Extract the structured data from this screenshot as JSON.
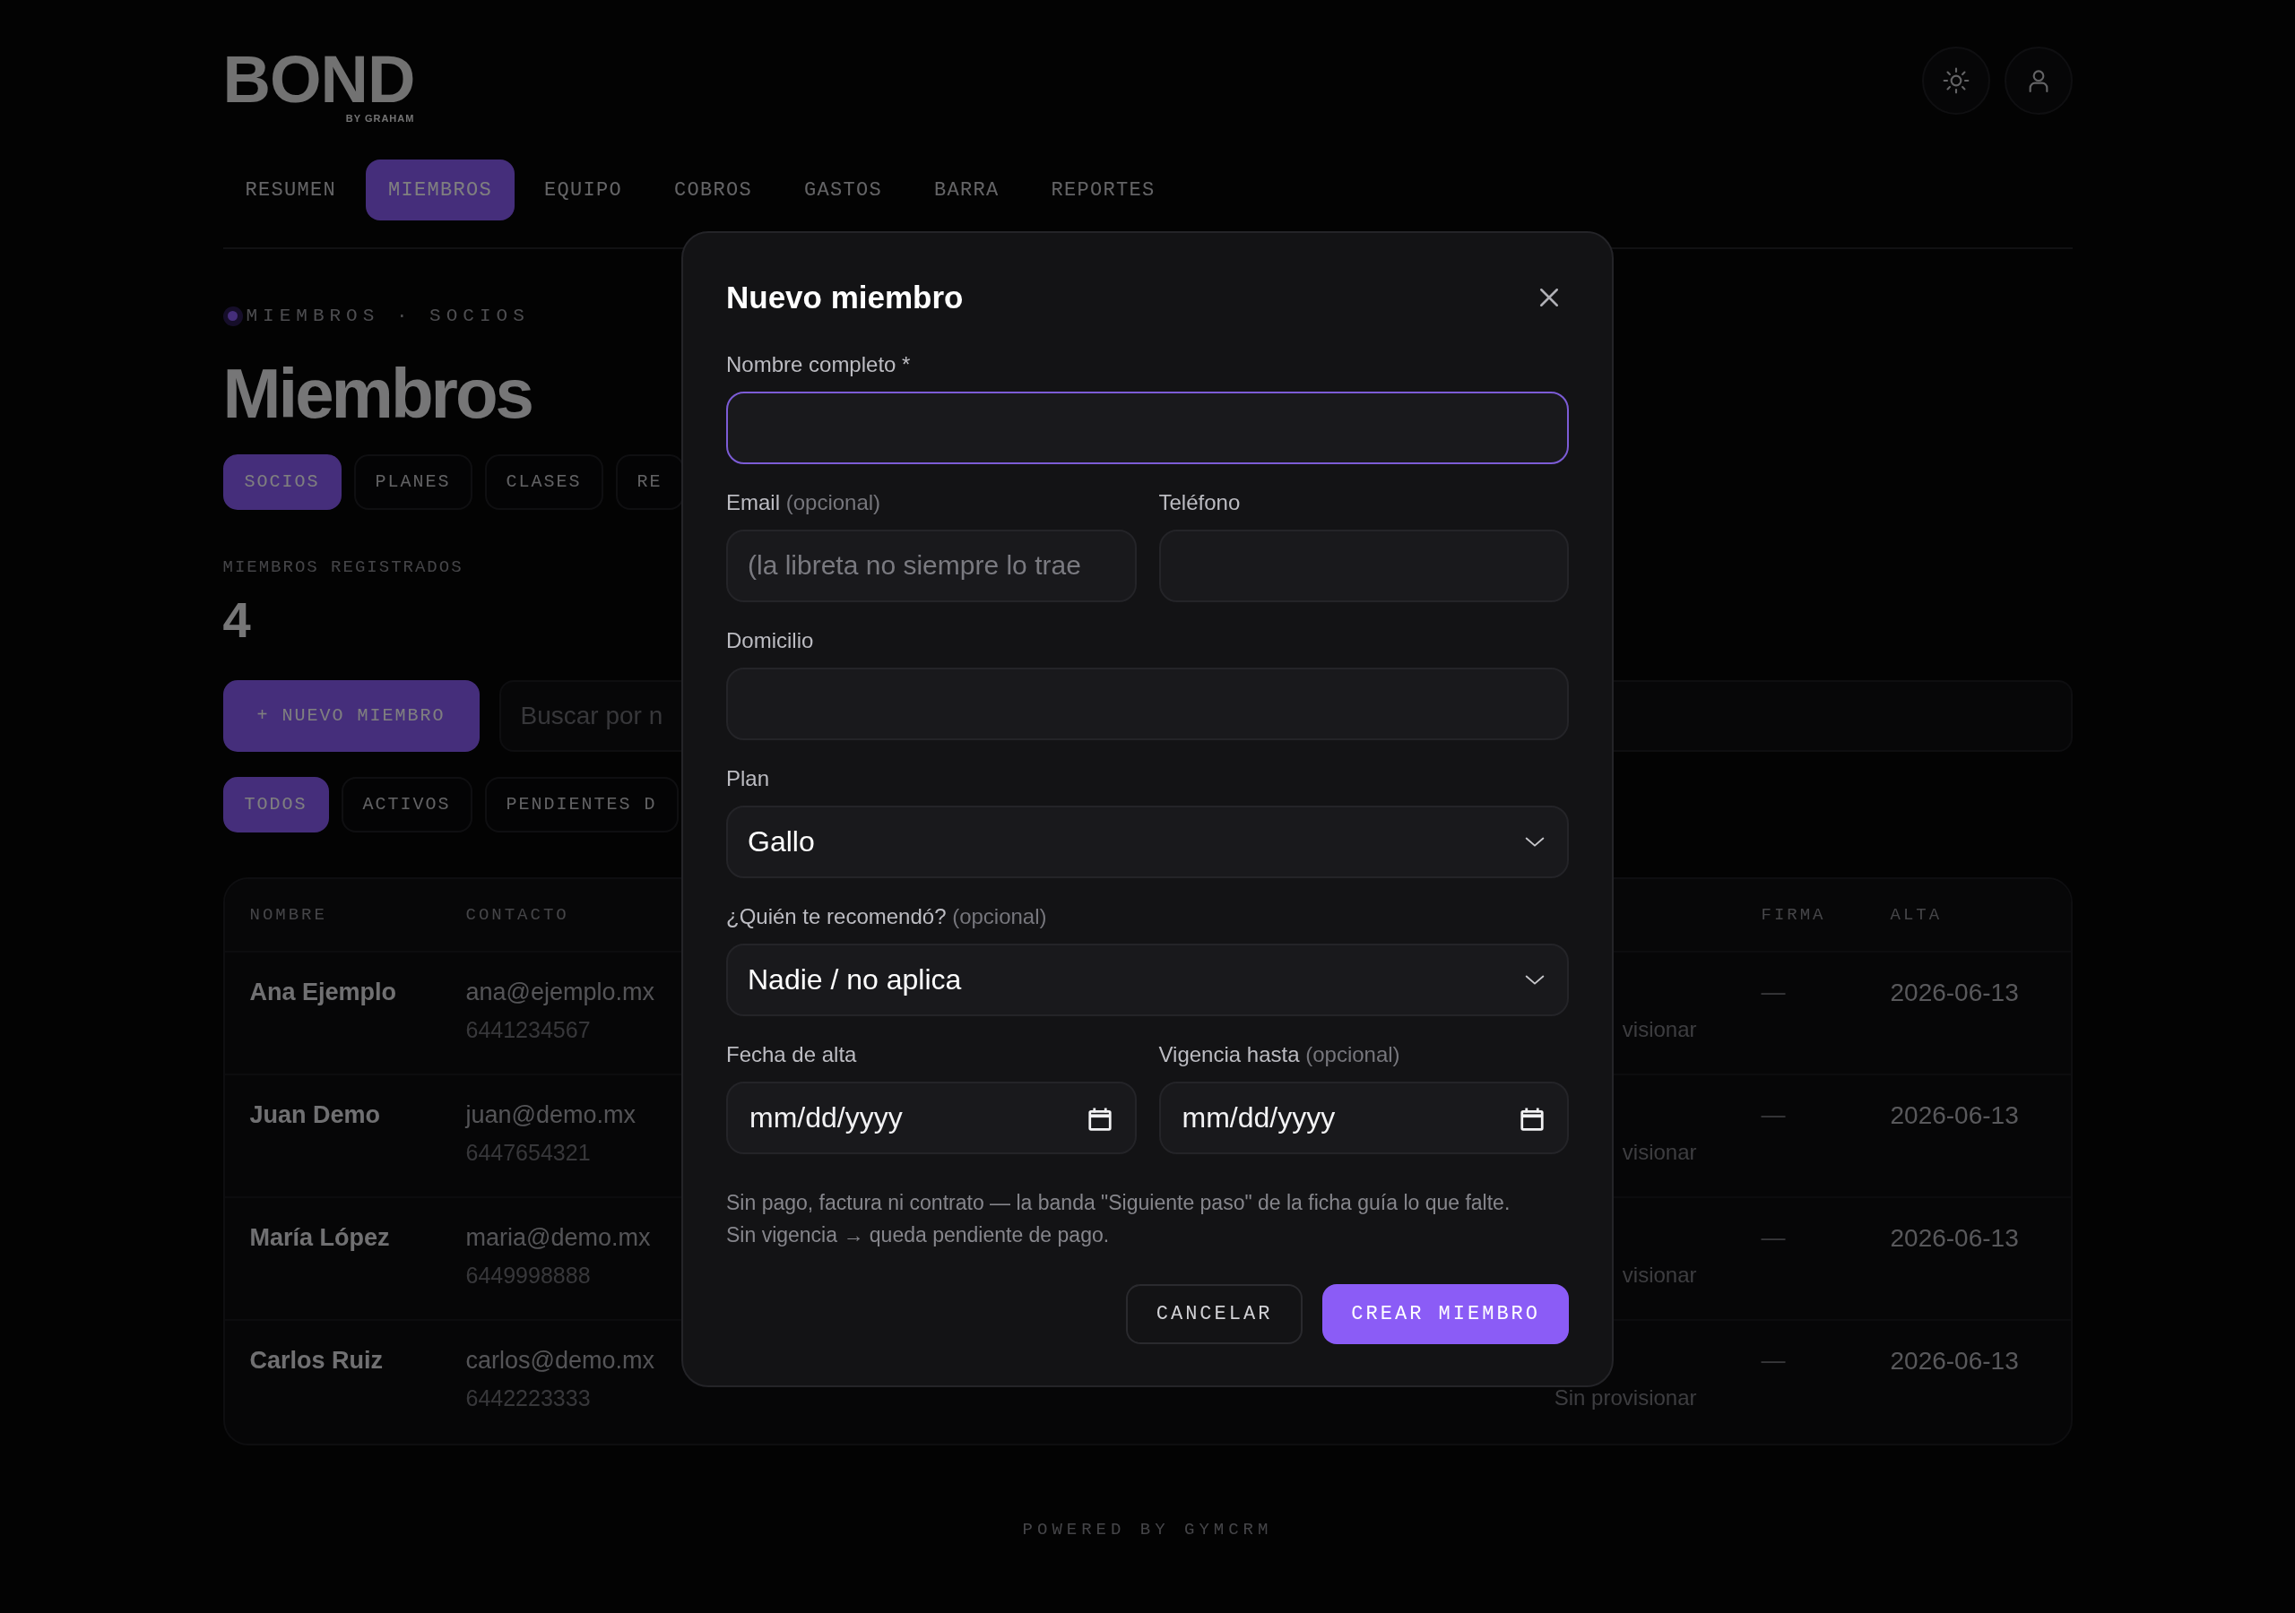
{
  "brand": {
    "name": "BOND",
    "tagline": "BY GRAHAM"
  },
  "nav": [
    {
      "label": "RESUMEN",
      "selected": false
    },
    {
      "label": "MIEMBROS",
      "selected": true
    },
    {
      "label": "EQUIPO",
      "selected": false
    },
    {
      "label": "COBROS",
      "selected": false
    },
    {
      "label": "GASTOS",
      "selected": false
    },
    {
      "label": "BARRA",
      "selected": false
    },
    {
      "label": "REPORTES",
      "selected": false
    }
  ],
  "breadcrumb": "MIEMBROS · SOCIOS",
  "title": "Miembros",
  "section_tabs": [
    {
      "label": "SOCIOS",
      "selected": true
    },
    {
      "label": "PLANES",
      "selected": false
    },
    {
      "label": "CLASES",
      "selected": false
    },
    {
      "label": "RE",
      "selected": false
    }
  ],
  "stat": {
    "label": "MIEMBROS REGISTRADOS",
    "value": "4"
  },
  "new_button": "+ NUEVO MIEMBRO",
  "search": {
    "placeholder": "Buscar por n"
  },
  "filters": [
    {
      "label": "TODOS",
      "selected": true
    },
    {
      "label": "ACTIVOS",
      "selected": false
    },
    {
      "label": "PENDIENTES D",
      "selected": false
    }
  ],
  "table": {
    "columns": [
      {
        "label": "NOMBRE"
      },
      {
        "label": "CONTACTO"
      },
      {
        "label": "FIRMA"
      },
      {
        "label": "ALTA"
      }
    ],
    "rows": [
      {
        "name": "Ana Ejemplo",
        "email": "ana@ejemplo.mx",
        "phone": "6441234567",
        "status_note": "visionar",
        "firma": "—",
        "alta": "2026-06-13"
      },
      {
        "name": "Juan Demo",
        "email": "juan@demo.mx",
        "phone": "6447654321",
        "status_note": "visionar",
        "firma": "—",
        "alta": "2026-06-13"
      },
      {
        "name": "María López",
        "email": "maria@demo.mx",
        "phone": "6449998888",
        "status_note": "visionar",
        "firma": "—",
        "alta": "2026-06-13"
      },
      {
        "name": "Carlos Ruiz",
        "email": "carlos@demo.mx",
        "phone": "6442223333",
        "status_note": "Sin provisionar",
        "firma": "—",
        "alta": "2026-06-13"
      }
    ]
  },
  "footer": "POWERED BY GYMCRM",
  "modal": {
    "title": "Nuevo miembro",
    "rows": [
      [
        {
          "kind": "text",
          "label": "Nombre completo *",
          "focused": true
        }
      ],
      [
        {
          "kind": "text",
          "label": "Email",
          "hint": "(opcional)",
          "placeholder": "(la libreta no siempre lo trae",
          "focused": false
        },
        {
          "kind": "text",
          "label": "Teléfono",
          "focused": false
        }
      ],
      [
        {
          "kind": "text",
          "label": "Domicilio",
          "focused": false
        }
      ],
      [
        {
          "kind": "select",
          "label": "Plan",
          "value": "Gallo",
          "focused": false
        }
      ],
      [
        {
          "kind": "select",
          "label": "¿Quién te recomendó?",
          "hint": "(opcional)",
          "value": "Nadie / no aplica",
          "focused": false
        }
      ],
      [
        {
          "kind": "date",
          "label": "Fecha de alta",
          "placeholder": "mm/dd/yyyy",
          "focused": false
        },
        {
          "kind": "date",
          "label": "Vigencia hasta",
          "hint": "(opcional)",
          "placeholder": "mm/dd/yyyy",
          "focused": false
        }
      ]
    ],
    "note_lines": [
      "Sin pago, factura ni contrato — la banda \"Siguiente paso\" de la ficha guía lo que falte.",
      "Sin vigencia → queda pendiente de pago."
    ],
    "buttons": [
      {
        "label": "CANCELAR",
        "kind": "secondary"
      },
      {
        "label": "CREAR MIEMBRO",
        "kind": "primary"
      }
    ]
  }
}
